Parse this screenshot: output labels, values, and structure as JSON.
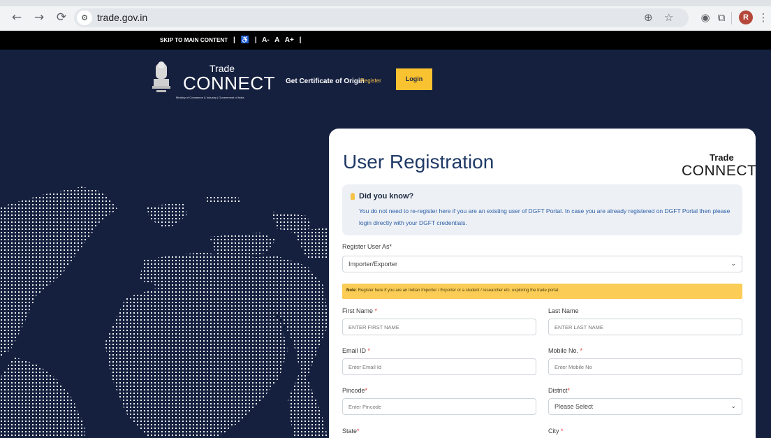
{
  "browser": {
    "url": "trade.gov.in",
    "profile_initial": "R"
  },
  "a11y_bar": {
    "skip_link": "SKIP TO MAIN CONTENT",
    "sep": "|",
    "font_small": "A-",
    "font_normal": "A",
    "font_large": "A+"
  },
  "header": {
    "logo_trade": "Trade",
    "logo_connect": "CONNECT",
    "logo_subtitle": "Ministry of Commerce & Industry | Government of India",
    "nav_certificate": "Get Certificate of Origin",
    "nav_register": "Register",
    "nav_login": "Login"
  },
  "card": {
    "title": "User Registration",
    "logo_trade": "Trade",
    "logo_connect": "CONNECT",
    "did_you_know_title": "Did you know?",
    "did_you_know_text": "You do not need to re-register here if you are an existing user of DGFT Portal. In case you are already registered on DGFT Portal then please login directly with your DGFT credentials.",
    "register_as_label": "Register User As*",
    "register_as_value": "Importer/Exporter",
    "note_prefix": "Note",
    "note_text": ": Register here if you are an Indian Importer / Exporter or a student / researcher etc. exploring the trade portal.",
    "first_name_label": "First Name",
    "first_name_placeholder": "ENTER FIRST NAME",
    "last_name_label": "Last Name",
    "last_name_placeholder": "ENTER LAST NAME",
    "email_label": "Email ID",
    "email_placeholder": "Enter Email Id",
    "mobile_label": "Mobile No.",
    "mobile_placeholder": "Enter Mobile No",
    "pincode_label": "Pincode",
    "pincode_placeholder": "Enter Pincode",
    "district_label": "District",
    "district_value": "Please Select",
    "state_label": "State",
    "city_label": "City",
    "required_mark": "*"
  },
  "colors": {
    "hero_bg": "#15203f",
    "accent": "#f9c230",
    "title": "#203a66"
  }
}
